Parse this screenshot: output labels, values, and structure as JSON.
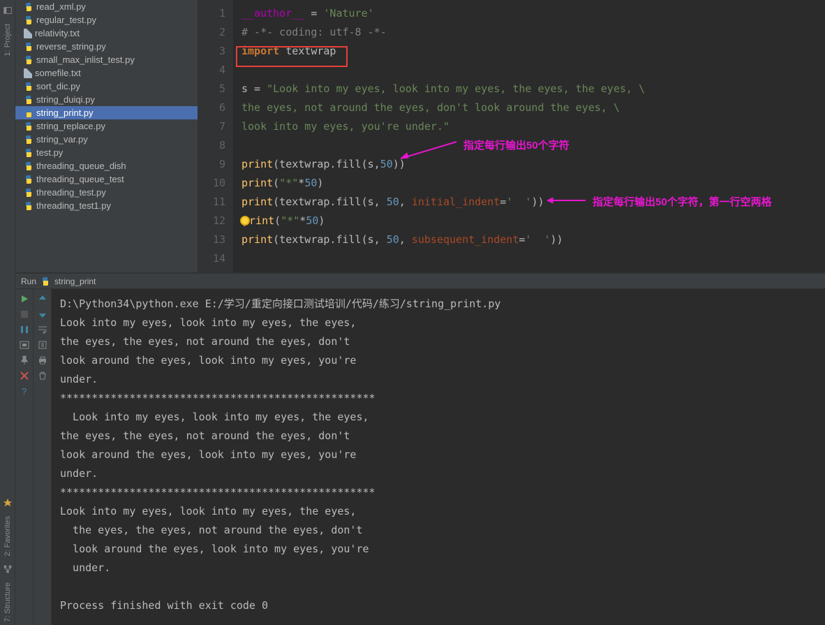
{
  "leftRail": {
    "project": "1: Project",
    "favorites": "2: Favorites",
    "structure": "7: Structure"
  },
  "tree": {
    "files": [
      {
        "name": "read_xml.py",
        "type": "py"
      },
      {
        "name": "regular_test.py",
        "type": "py"
      },
      {
        "name": "relativity.txt",
        "type": "txt"
      },
      {
        "name": "reverse_string.py",
        "type": "py"
      },
      {
        "name": "small_max_inlist_test.py",
        "type": "py"
      },
      {
        "name": "somefile.txt",
        "type": "txt"
      },
      {
        "name": "sort_dic.py",
        "type": "py"
      },
      {
        "name": "string_duiqi.py",
        "type": "py"
      },
      {
        "name": "string_print.py",
        "type": "py",
        "selected": true
      },
      {
        "name": "string_replace.py",
        "type": "py"
      },
      {
        "name": "string_var.py",
        "type": "py"
      },
      {
        "name": "test.py",
        "type": "py"
      },
      {
        "name": "threading_queue_dish",
        "type": "py"
      },
      {
        "name": "threading_queue_test",
        "type": "py"
      },
      {
        "name": "threading_test.py",
        "type": "py"
      },
      {
        "name": "threading_test1.py",
        "type": "py"
      }
    ]
  },
  "editor": {
    "lineStart": 1,
    "lineEnd": 14,
    "lines": {
      "l1_dunder": "__author__",
      "l1_eq": " = ",
      "l1_str": "'Nature'",
      "l2": "# -*- coding: utf-8 -*-",
      "l3_kw": "import",
      "l3_mod": " textwrap",
      "l5_var": "s = ",
      "l5_str": "\"Look into my eyes, look into my eyes, the eyes, the eyes, \\",
      "l6": "the eyes, not around the eyes, don't look around the eyes, \\",
      "l7": "look into my eyes, you're under.\"",
      "l9_a": "print",
      "l9_b": "(textwrap.fill(s,",
      "l9_c": "50",
      "l9_d": "))",
      "l10_a": "print",
      "l10_b": "(",
      "l10_c": "\"*\"",
      "l10_d": "*",
      "l10_e": "50",
      "l10_f": ")",
      "l11_a": "print",
      "l11_b": "(textwrap.fill(s, ",
      "l11_c": "50",
      "l11_d": ", ",
      "l11_e": "initial_indent",
      "l11_f": "=",
      "l11_g": "'  '",
      "l11_h": "))",
      "l12_a": "print",
      "l12_b": "(",
      "l12_c": "\"*\"",
      "l12_d": "*",
      "l12_e": "50",
      "l12_f": ")",
      "l13_a": "print",
      "l13_b": "(textwrap.fill(s, ",
      "l13_c": "50",
      "l13_d": ", ",
      "l13_e": "subsequent_indent",
      "l13_f": "=",
      "l13_g": "'  '",
      "l13_h": "))"
    },
    "annotation1": "指定每行输出50个字符",
    "annotation2": "指定每行输出50个字符，第一行空两格"
  },
  "run": {
    "tabLabel": "Run",
    "configName": "string_print",
    "output": "D:\\Python34\\python.exe E:/学习/重定向接口测试培训/代码/练习/string_print.py\nLook into my eyes, look into my eyes, the eyes,\nthe eyes, the eyes, not around the eyes, don't\nlook around the eyes, look into my eyes, you're\nunder.\n**************************************************\n  Look into my eyes, look into my eyes, the eyes,\nthe eyes, the eyes, not around the eyes, don't\nlook around the eyes, look into my eyes, you're\nunder.\n**************************************************\nLook into my eyes, look into my eyes, the eyes,\n  the eyes, the eyes, not around the eyes, don't\n  look around the eyes, look into my eyes, you're\n  under.\n\nProcess finished with exit code 0"
  }
}
